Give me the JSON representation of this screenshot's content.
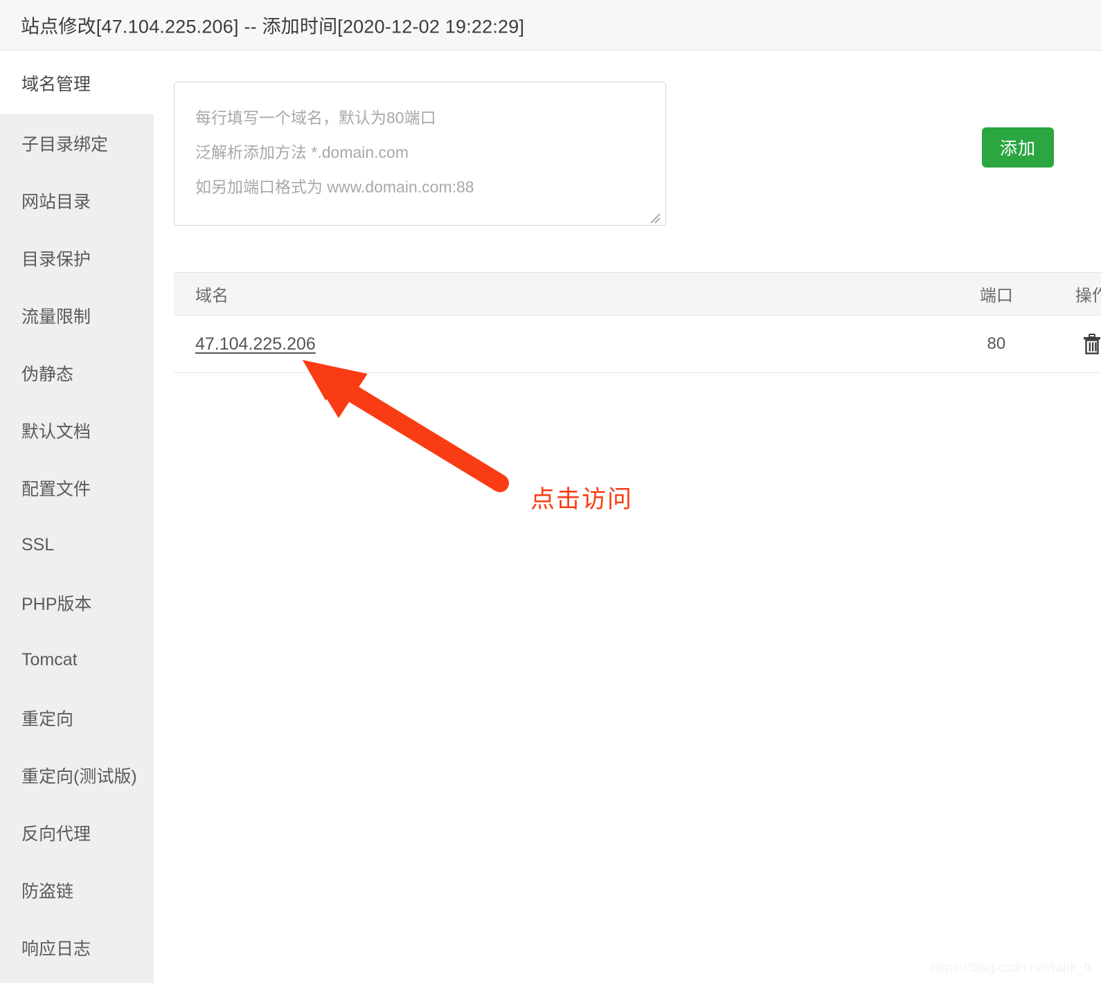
{
  "header": {
    "title": "站点修改[47.104.225.206] -- 添加时间[2020-12-02 19:22:29]"
  },
  "sidebar": {
    "items": [
      {
        "label": "域名管理",
        "active": true
      },
      {
        "label": "子目录绑定",
        "active": false
      },
      {
        "label": "网站目录",
        "active": false
      },
      {
        "label": "目录保护",
        "active": false
      },
      {
        "label": "流量限制",
        "active": false
      },
      {
        "label": "伪静态",
        "active": false
      },
      {
        "label": "默认文档",
        "active": false
      },
      {
        "label": "配置文件",
        "active": false
      },
      {
        "label": "SSL",
        "active": false
      },
      {
        "label": "PHP版本",
        "active": false
      },
      {
        "label": "Tomcat",
        "active": false
      },
      {
        "label": "重定向",
        "active": false
      },
      {
        "label": "重定向(测试版)",
        "active": false
      },
      {
        "label": "反向代理",
        "active": false
      },
      {
        "label": "防盗链",
        "active": false
      },
      {
        "label": "响应日志",
        "active": false
      }
    ]
  },
  "main": {
    "domain_input": {
      "value": "",
      "placeholder": "每行填写一个域名，默认为80端口\n泛解析添加方法 *.domain.com\n如另加端口格式为 www.domain.com:88"
    },
    "add_button_label": "添加",
    "table": {
      "columns": [
        "域名",
        "端口",
        "操作"
      ],
      "rows": [
        {
          "domain": "47.104.225.206",
          "port": "80",
          "action_icon": "trash-icon"
        }
      ]
    }
  },
  "annotation": {
    "text": "点击访问",
    "color": "#fa3c14"
  },
  "watermark": {
    "text": "https://blog.csdn.net/tank_ft"
  },
  "colors": {
    "accent_green": "#2ba641",
    "annotation_red": "#fa3c14",
    "sidebar_bg": "#efefef",
    "header_bg": "#f7f7f7"
  }
}
